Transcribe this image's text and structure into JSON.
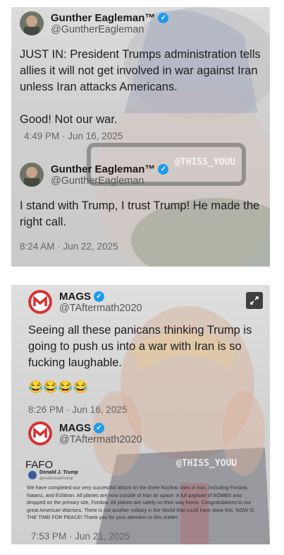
{
  "post1": {
    "tweet_a": {
      "name": "Gunther Eagleman™",
      "handle": "@GuntherEagleman",
      "text": "JUST IN: President Trumps administration tells allies it will not get involved in war against Iran unless Iran attacks Americans.",
      "text2": "Good!  Not our war.",
      "time": "4:49 PM · Jun 16, 2025"
    },
    "tweet_b": {
      "name": "Gunther Eagleman™",
      "handle": "@GuntherEagleman",
      "text": "I stand with Trump, I trust Trump!  He made the right call.",
      "time": "8:24 AM · Jun 22, 2025"
    },
    "watermark": "@THISS_YOUU"
  },
  "post2": {
    "tweet_a": {
      "name": "MAGS",
      "handle": "@TAftermath2020",
      "text": "Seeing all these panicans thinking Trump is going to push us into a war with Iran is so fucking laughable.",
      "emoji": "😂😂😂😂",
      "time": "8:26 PM · Jun 16, 2025"
    },
    "tweet_b": {
      "name": "MAGS",
      "handle": "@TAftermath2020",
      "text": "FAFO",
      "time": "7:53 PM · Jun 21, 2025"
    },
    "inner_tweet": {
      "name": "Donald J. Trump",
      "handle": "@realDonaldTrump",
      "text": "We have completed our very successful attack on the three Nuclear sites in Iran, including Fordow, Natanz, and Esfahan. All planes are now outside of Iran air space. A full payload of BOMBS was dropped on the primary site, Fordow. All planes are safely on their way home. Congratulations to our great American Warriors. There is not another military in the World that could have done this. NOW IS THE TIME FOR PEACE! Thank you for your attention to this matter."
    },
    "watermark": "@THISS_YOUU",
    "expand_icon": "expand-icon"
  }
}
